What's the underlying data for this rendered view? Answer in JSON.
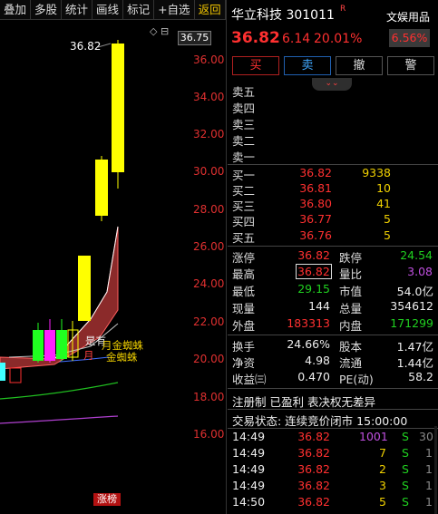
{
  "toolbar": {
    "items": [
      "叠加",
      "多股",
      "统计",
      "画线",
      "标记",
      "+自选",
      "返回"
    ]
  },
  "chart": {
    "current_price_flag": "36.75",
    "high_label": "36.82",
    "top_icons": "◇ ⊟",
    "y_ticks": [
      "36.00",
      "34.00",
      "32.00",
      "30.00",
      "28.00",
      "26.00",
      "24.00",
      "22.00",
      "20.00",
      "18.00",
      "16.00"
    ],
    "legend_shi_you": "是有",
    "legend_gold_spider_1": "月金蜘蛛",
    "legend_yue_red": "月",
    "legend_gold_spider_2": "金蜘蛛",
    "tag": "涨榜",
    "colors": {
      "up_candle": "#ffff00",
      "down_candle": "#20ff20",
      "magenta_candle": "#ff20ff",
      "cyan_candle": "#40ffff"
    }
  },
  "quote": {
    "name_code": "华立科技 301011",
    "badge": "R",
    "sector": "文娱用品",
    "price": "36.82",
    "change": "6.14",
    "change_pct": "20.01%",
    "sector_pct": "6.56%",
    "buttons": {
      "buy": "买",
      "sell": "卖",
      "cancel": "撤",
      "alert": "警"
    },
    "collapse_icon": "chevron-double-down-icon",
    "sell_levels": [
      {
        "label": "卖五"
      },
      {
        "label": "卖四"
      },
      {
        "label": "卖三"
      },
      {
        "label": "卖二"
      },
      {
        "label": "卖一"
      }
    ],
    "buy_levels": [
      {
        "label": "买一",
        "price": "36.82",
        "volume": "9338"
      },
      {
        "label": "买二",
        "price": "36.81",
        "volume": "10"
      },
      {
        "label": "买三",
        "price": "36.80",
        "volume": "41"
      },
      {
        "label": "买四",
        "price": "36.77",
        "volume": "5"
      },
      {
        "label": "买五",
        "price": "36.76",
        "volume": "5"
      }
    ],
    "stats": {
      "limit_up_label": "涨停",
      "limit_up": "36.82",
      "limit_down_label": "跌停",
      "limit_down": "24.54",
      "high_label": "最高",
      "high": "36.82",
      "vol_ratio_label": "量比",
      "vol_ratio": "3.08",
      "low_label": "最低",
      "low": "29.15",
      "mkt_cap_label": "市值",
      "mkt_cap": "54.0亿",
      "cur_vol_label": "现量",
      "cur_vol": "144",
      "total_vol_label": "总量",
      "total_vol": "354612",
      "outer_label": "外盘",
      "outer": "183313",
      "inner_label": "内盘",
      "inner": "171299",
      "turnover_label": "换手",
      "turnover": "24.66%",
      "equity_label": "股本",
      "equity": "1.47亿",
      "nav_label": "净资",
      "nav": "4.98",
      "float_label": "流通",
      "float": "1.44亿",
      "eps_label": "收益㈢",
      "eps": "0.470",
      "pe_label": "PE(动)",
      "pe": "58.2"
    },
    "tags_line": "注册制 已盈利 表决权无差异",
    "status_line": "交易状态: 连续竞价闭市 15:00:00",
    "ticks": [
      {
        "time": "14:49",
        "price": "36.82",
        "volume": "1001",
        "side": "S",
        "count": "30"
      },
      {
        "time": "14:49",
        "price": "36.82",
        "volume": "7",
        "side": "S",
        "count": "1"
      },
      {
        "time": "14:49",
        "price": "36.82",
        "volume": "2",
        "side": "S",
        "count": "1"
      },
      {
        "time": "14:49",
        "price": "36.82",
        "volume": "3",
        "side": "S",
        "count": "1"
      },
      {
        "time": "14:50",
        "price": "36.82",
        "volume": "5",
        "side": "S",
        "count": "1"
      }
    ]
  }
}
